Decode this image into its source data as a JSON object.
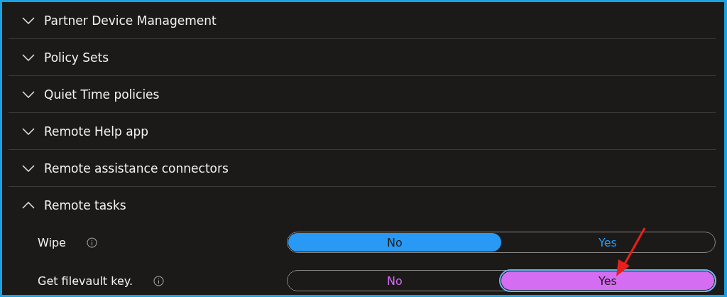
{
  "sections": [
    {
      "title": "Partner Device Management",
      "expanded": false
    },
    {
      "title": "Policy Sets",
      "expanded": false
    },
    {
      "title": "Quiet Time policies",
      "expanded": false
    },
    {
      "title": "Remote Help app",
      "expanded": false
    },
    {
      "title": "Remote assistance connectors",
      "expanded": false
    },
    {
      "title": "Remote tasks",
      "expanded": true,
      "settings": [
        {
          "label": "Wipe",
          "color": "#2899f5",
          "focused": false,
          "options": [
            {
              "label": "No",
              "selected": true
            },
            {
              "label": "Yes",
              "selected": false
            }
          ]
        },
        {
          "label": "Get filevault key.",
          "color": "#d56df2",
          "focused": true,
          "options": [
            {
              "label": "No",
              "selected": false
            },
            {
              "label": "Yes",
              "selected": true
            }
          ]
        }
      ]
    }
  ]
}
